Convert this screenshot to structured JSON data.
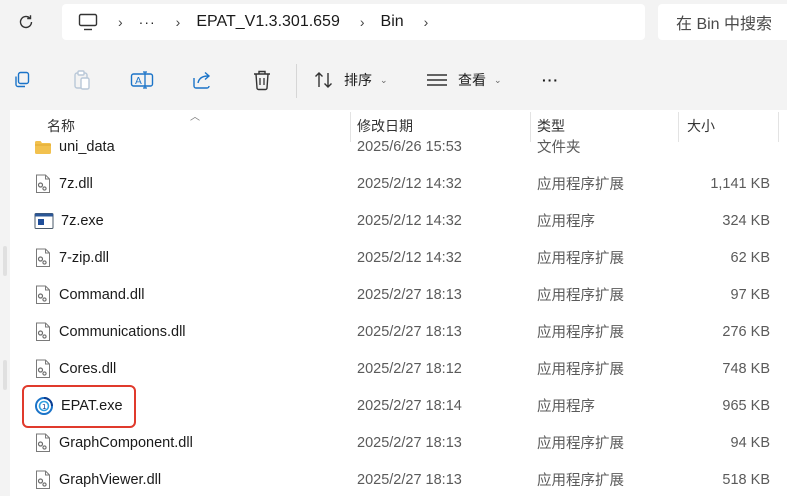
{
  "address_bar": {
    "breadcrumbs": [
      "EPAT_V1.3.301.659",
      "Bin"
    ],
    "overflow": "···",
    "search_placeholder": "在 Bin 中搜索"
  },
  "toolbar": {
    "sort_label": "排序",
    "view_label": "查看",
    "more_label": "···"
  },
  "columns": {
    "name": "名称",
    "date": "修改日期",
    "type": "类型",
    "size": "大小"
  },
  "files": [
    {
      "name": "uni_data",
      "date": "2025/6/26 15:53",
      "type": "文件夹",
      "size": "",
      "icon": "folder-icon"
    },
    {
      "name": "7z.dll",
      "date": "2025/2/12 14:32",
      "type": "应用程序扩展",
      "size": "1,141 KB",
      "icon": "dll-file-icon"
    },
    {
      "name": "7z.exe",
      "date": "2025/2/12 14:32",
      "type": "应用程序",
      "size": "324 KB",
      "icon": "exe-7z-icon"
    },
    {
      "name": "7-zip.dll",
      "date": "2025/2/12 14:32",
      "type": "应用程序扩展",
      "size": "62 KB",
      "icon": "dll-file-icon"
    },
    {
      "name": "Command.dll",
      "date": "2025/2/27 18:13",
      "type": "应用程序扩展",
      "size": "97 KB",
      "icon": "dll-file-icon"
    },
    {
      "name": "Communications.dll",
      "date": "2025/2/27 18:13",
      "type": "应用程序扩展",
      "size": "276 KB",
      "icon": "dll-file-icon"
    },
    {
      "name": "Cores.dll",
      "date": "2025/2/27 18:12",
      "type": "应用程序扩展",
      "size": "748 KB",
      "icon": "dll-file-icon"
    },
    {
      "name": "EPAT.exe",
      "date": "2025/2/27 18:14",
      "type": "应用程序",
      "size": "965 KB",
      "icon": "epat-app-icon",
      "highlighted": true
    },
    {
      "name": "GraphComponent.dll",
      "date": "2025/2/27 18:13",
      "type": "应用程序扩展",
      "size": "94 KB",
      "icon": "dll-file-icon"
    },
    {
      "name": "GraphViewer.dll",
      "date": "2025/2/27 18:13",
      "type": "应用程序扩展",
      "size": "518 KB",
      "icon": "dll-file-icon"
    }
  ],
  "colors": {
    "highlight_border": "#e03a2c",
    "folder": "#f2c14e",
    "accent": "#1a73c8"
  }
}
